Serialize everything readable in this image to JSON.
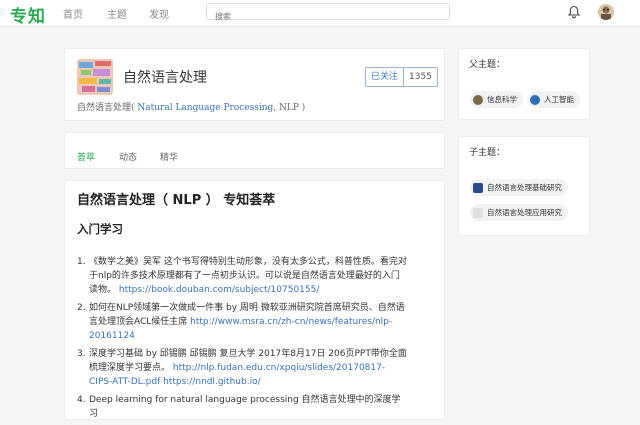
{
  "header": {
    "logo": "专知",
    "nav": [
      "首页",
      "主题",
      "发现"
    ],
    "search_placeholder": "搜索"
  },
  "topic": {
    "title": "自然语言处理",
    "follow_label": "已关注",
    "follow_count": "1355",
    "subtitle_prefix": "自然语言处理(",
    "subtitle_en": "Natural Language Processing",
    "subtitle_suffix": ", NLP )"
  },
  "tabs": [
    "荟萃",
    "动态",
    "精华"
  ],
  "article": {
    "title": "自然语言处理（ NLP ） 专知荟萃",
    "section": "入门学习",
    "items": [
      {
        "num": "1.",
        "text": "《数学之美》吴军 这个书写得特别生动形象，没有太多公式，科普性质。看完对于nlp的许多技术原理都有了一点初步认识。可以说是自然语言处理最好的入门读物。 ",
        "link": "https://book.douban.com/subject/10750155/"
      },
      {
        "num": "2.",
        "text": "如何在NLP领域第一次做成一件事 by 周明 微软亚洲研究院首席研究员、自然语言处理顶会ACL候任主席 ",
        "link": "http://www.msra.cn/zh-cn/news/features/nlp-20161124"
      },
      {
        "num": "3.",
        "text": "深度学习基础 by 邱锡鹏 邱锡鹏 复旦大学 2017年8月17日 206页PPT带你全面梳理深度学习要点。 ",
        "link": "http://nlp.fudan.edu.cn/xpqiu/slides/20170817-CIPS-ATT-DL.pdf https://nndl.github.io/"
      },
      {
        "num": "4.",
        "text": "Deep learning for natural language processing 自然语言处理中的深度学习",
        "link": ""
      }
    ]
  },
  "parent_topics": {
    "heading": "父主题：",
    "items": [
      "信息科学",
      "人工智能"
    ]
  },
  "child_topics": {
    "heading": "子主题：",
    "items": [
      "自然语言处理基础研究",
      "自然语言处理应用研究"
    ]
  },
  "colors": {
    "brand": "#2bab54",
    "link": "#3a72b5",
    "follow_border": "#9ab4d8"
  }
}
